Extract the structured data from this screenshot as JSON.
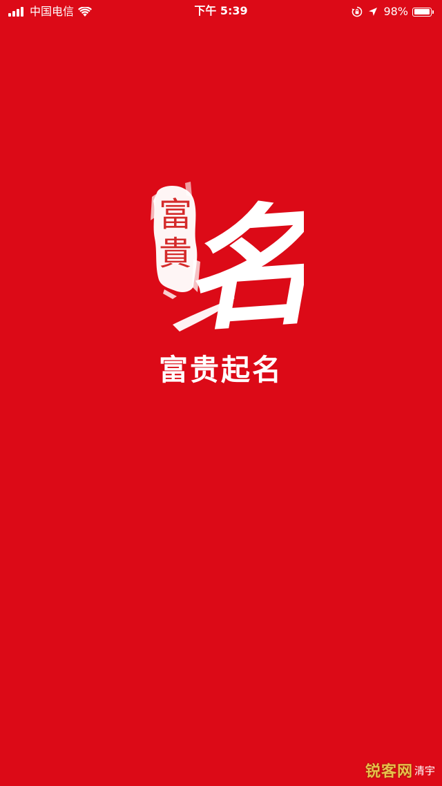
{
  "status_bar": {
    "carrier": "中国电信",
    "time": "下午 5:39",
    "battery_percent": "98%",
    "battery_level": 0.98,
    "icons": [
      "signal-bars-icon",
      "wifi-icon",
      "orientation-lock-icon",
      "location-arrow-icon",
      "battery-icon"
    ]
  },
  "splash": {
    "seal_text": "富貴",
    "calligraphy_char": "名",
    "app_name": "富贵起名",
    "background_color": "#dc0a17",
    "seal_color": "#d42a2a"
  },
  "watermark": {
    "logo_text": "锐客网",
    "credit_text": "清宇"
  }
}
